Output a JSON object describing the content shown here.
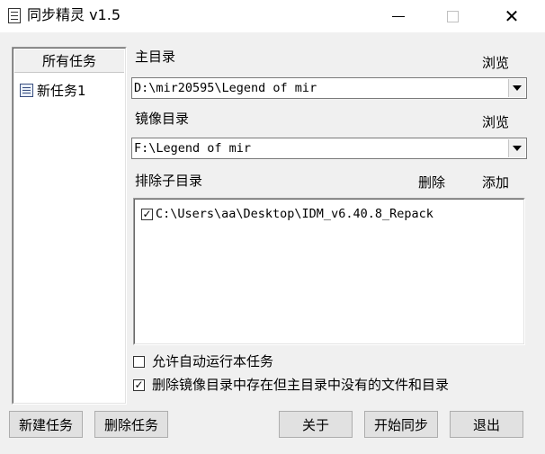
{
  "window": {
    "title": "同步精灵 v1.5",
    "controls": {
      "minimize": "–",
      "maximize": "□",
      "close": "✕"
    }
  },
  "tasks": {
    "header": "所有任务",
    "items": [
      {
        "label": "新任务1"
      }
    ]
  },
  "main_dir": {
    "label": "主目录",
    "browse": "浏览",
    "value": "D:\\mir20595\\Legend of mir"
  },
  "mirror_dir": {
    "label": "镜像目录",
    "browse": "浏览",
    "value": "F:\\Legend of mir"
  },
  "exclude": {
    "label": "排除子目录",
    "delete": "删除",
    "add": "添加",
    "items": [
      {
        "path": "C:\\Users\\aa\\Desktop\\IDM_v6.40.8_Repack",
        "checked": true
      }
    ]
  },
  "options": {
    "auto_run": {
      "label": "允许自动运行本任务",
      "checked": false
    },
    "delete_extra": {
      "label": "删除镜像目录中存在但主目录中没有的文件和目录",
      "checked": true
    }
  },
  "buttons": {
    "new_task": "新建任务",
    "delete_task": "删除任务",
    "about": "关于",
    "start_sync": "开始同步",
    "exit": "退出"
  },
  "icons": {
    "app": "app-document-icon",
    "task": "task-document-icon",
    "check": "✓"
  }
}
